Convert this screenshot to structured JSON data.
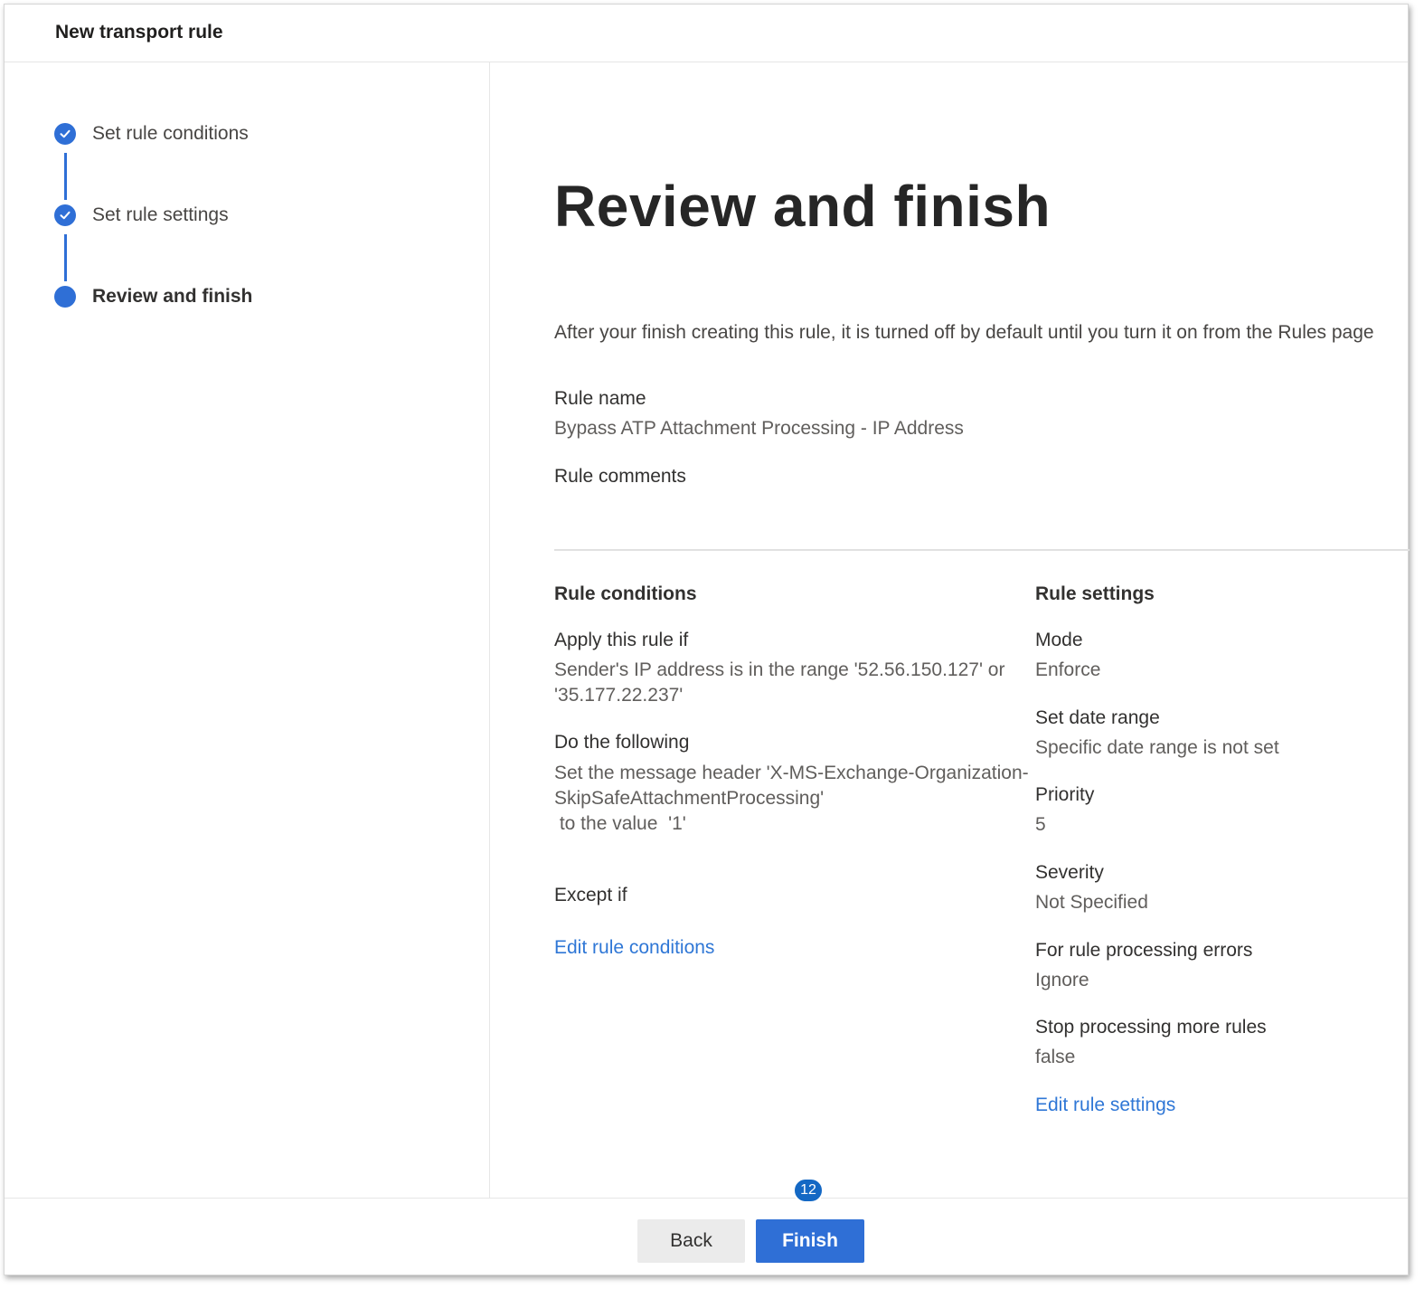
{
  "header": {
    "title": "New transport rule"
  },
  "steps": [
    {
      "label": "Set rule conditions",
      "state": "completed"
    },
    {
      "label": "Set rule settings",
      "state": "completed"
    },
    {
      "label": "Review and finish",
      "state": "current"
    }
  ],
  "colors": {
    "accent": "#2f6fd6",
    "link": "#2f77d6",
    "badge": "#1468c4"
  },
  "main": {
    "title": "Review and finish",
    "intro": "After your finish creating this rule, it is turned off by default until you turn it on from the Rules page",
    "rule_name_label": "Rule name",
    "rule_name_value": "Bypass ATP Attachment Processing - IP Address",
    "rule_comments_label": "Rule comments"
  },
  "conditions": {
    "section_title": "Rule conditions",
    "apply_label": "Apply this rule if",
    "apply_value": "Sender's IP address is in the range '52.56.150.127' or '35.177.22.237'",
    "do_label": "Do the following",
    "do_value_line1": "Set the message header  'X-MS-Exchange-Organization-SkipSafeAttachmentProcessing'",
    "do_value_line2": " to the value  '1'",
    "except_label": "Except if",
    "edit_link": "Edit rule conditions"
  },
  "settings": {
    "section_title": "Rule settings",
    "mode_label": "Mode",
    "mode_value": "Enforce",
    "date_label": "Set date range",
    "date_value": "Specific date range is not set",
    "priority_label": "Priority",
    "priority_value": "5",
    "severity_label": "Severity",
    "severity_value": "Not Specified",
    "errors_label": "For rule processing errors",
    "errors_value": "Ignore",
    "stop_label": "Stop processing more rules",
    "stop_value": "false",
    "edit_link": "Edit rule settings"
  },
  "footer": {
    "back_label": "Back",
    "finish_label": "Finish",
    "badge": "12"
  }
}
